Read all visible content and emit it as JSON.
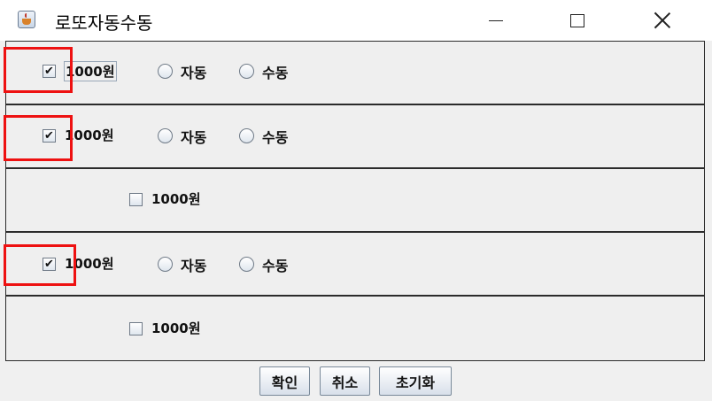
{
  "window": {
    "title": "로또자동수동"
  },
  "rows": [
    {
      "checked": true,
      "label": "1000원",
      "auto_label": "자동",
      "manual_label": "수동",
      "show_radios": true
    },
    {
      "checked": true,
      "label": "1000원",
      "auto_label": "자동",
      "manual_label": "수동",
      "show_radios": true
    },
    {
      "checked": false,
      "label": "1000원",
      "show_radios": false
    },
    {
      "checked": true,
      "label": "1000원",
      "auto_label": "자동",
      "manual_label": "수동",
      "show_radios": true
    },
    {
      "checked": false,
      "label": "1000원",
      "show_radios": false
    }
  ],
  "buttons": {
    "confirm": "확인",
    "cancel": "취소",
    "reset": "초기화"
  },
  "marks": {
    "check": "✔"
  },
  "colors": {
    "highlight": "#ee1111"
  }
}
